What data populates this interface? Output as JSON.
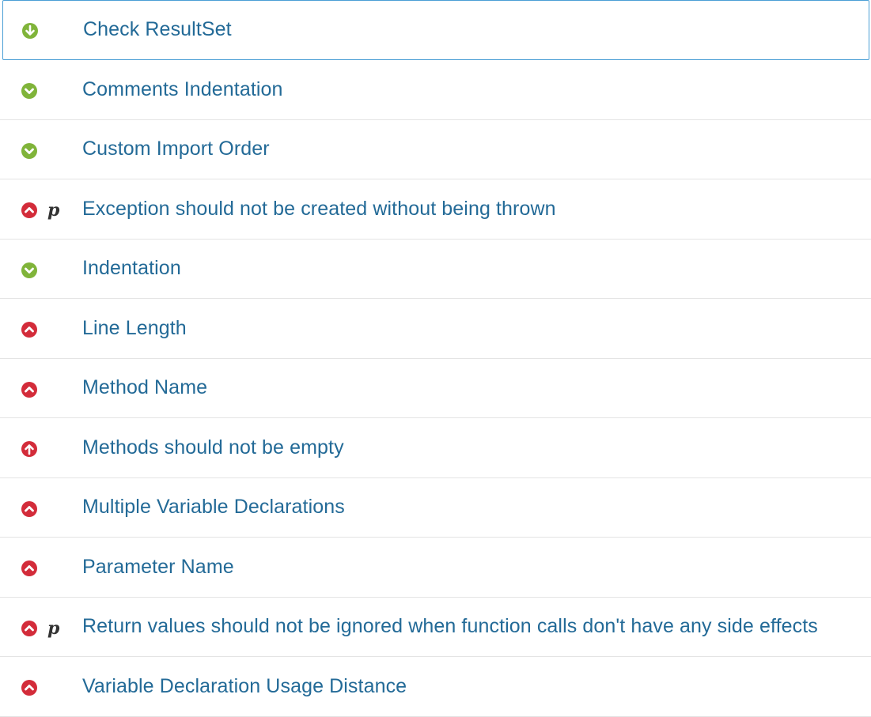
{
  "colors": {
    "pass": "#80b43a",
    "fail": "#d32c3a",
    "label": "#236a97",
    "selected_border": "#4b9fd5"
  },
  "rules": [
    {
      "label": "Check ResultSet",
      "status": "pass",
      "icon": "circle-arrow-down-icon",
      "template": false,
      "selected": true
    },
    {
      "label": "Comments Indentation",
      "status": "pass",
      "icon": "circle-chevron-down-icon",
      "template": false
    },
    {
      "label": "Custom Import Order",
      "status": "pass",
      "icon": "circle-chevron-down-icon",
      "template": false
    },
    {
      "label": "Exception should not be created without being thrown",
      "status": "fail",
      "icon": "circle-chevron-up-icon",
      "template": true,
      "template_glyph": "p"
    },
    {
      "label": "Indentation",
      "status": "pass",
      "icon": "circle-chevron-down-icon",
      "template": false
    },
    {
      "label": "Line Length",
      "status": "fail",
      "icon": "circle-chevron-up-icon",
      "template": false
    },
    {
      "label": "Method Name",
      "status": "fail",
      "icon": "circle-chevron-up-icon",
      "template": false
    },
    {
      "label": "Methods should not be empty",
      "status": "fail",
      "icon": "circle-arrow-up-icon",
      "template": false
    },
    {
      "label": "Multiple Variable Declarations",
      "status": "fail",
      "icon": "circle-chevron-up-icon",
      "template": false
    },
    {
      "label": "Parameter Name",
      "status": "fail",
      "icon": "circle-chevron-up-icon",
      "template": false
    },
    {
      "label": "Return values should not be ignored when function calls don't have any side effects",
      "status": "fail",
      "icon": "circle-chevron-up-icon",
      "template": true,
      "template_glyph": "p"
    },
    {
      "label": "Variable Declaration Usage Distance",
      "status": "fail",
      "icon": "circle-chevron-up-icon",
      "template": false
    }
  ]
}
